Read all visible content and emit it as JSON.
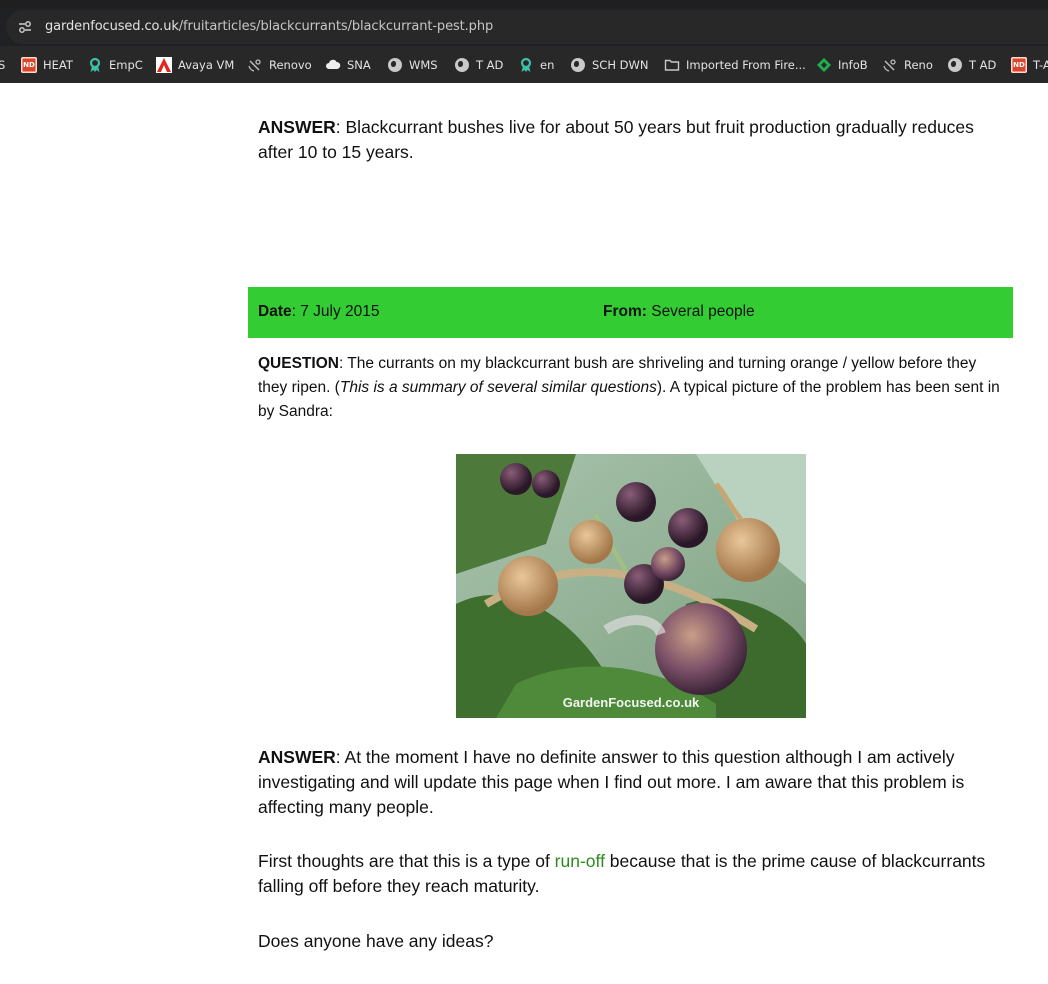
{
  "browser": {
    "url_host": "gardenfocused.co.uk",
    "url_path": "/fruitarticles/blackcurrants/blackcurrant-pest.php",
    "bookmarks": [
      {
        "label": "S",
        "icon": "cut-off-icon"
      },
      {
        "label": "HEAT",
        "icon": "nd-icon"
      },
      {
        "label": "EmpC",
        "icon": "ribbon-icon"
      },
      {
        "label": "Avaya VM",
        "icon": "adobe-icon"
      },
      {
        "label": "Renovo",
        "icon": "satellite-icon"
      },
      {
        "label": "SNA",
        "icon": "cloud-icon"
      },
      {
        "label": "WMS",
        "icon": "globe-icon"
      },
      {
        "label": "T AD",
        "icon": "globe-icon"
      },
      {
        "label": "en",
        "icon": "ribbon-icon"
      },
      {
        "label": "SCH DWN",
        "icon": "globe-icon"
      },
      {
        "label": "Imported From Fire...",
        "icon": "folder-icon"
      },
      {
        "label": "InfoB",
        "icon": "diamond-icon"
      },
      {
        "label": "Reno",
        "icon": "satellite-icon"
      },
      {
        "label": "T AD",
        "icon": "globe-icon"
      },
      {
        "label": "T-A",
        "icon": "nd-icon"
      }
    ]
  },
  "article": {
    "answer1_label": "ANSWER",
    "answer1_text": ": Blackcurrant bushes live for about 50 years but fruit production gradually reduces after 10 to 15 years.",
    "date_label": "Date",
    "date_value": ": 7 July 2015",
    "from_label": "From:",
    "from_value": " Several people",
    "question_label": "QUESTION",
    "question_text_1": ": The currants on my blackcurrant bush are shriveling and turning orange / yellow before they they ripen. (",
    "question_italic": "This is a summary of several similar questions",
    "question_text_2": "). A typical picture of the problem has been sent in by Sandra:",
    "image_watermark": "GardenFocused.co.uk",
    "answer2_label": "ANSWER",
    "answer2_text": ": At the moment I have no definite answer to this question although I am actively investigating and will update this page when I find out more. I am aware that this problem is affecting many people.",
    "thoughts_text_1": "First thoughts are that this is a type of ",
    "thoughts_link": "run-off",
    "thoughts_text_2": " because that is the prime cause of blackcurrants falling off before they reach maturity.",
    "ideas_text": "Does anyone have any ideas?"
  },
  "colors": {
    "header_bar": "#33cc33",
    "link": "#2e8b20"
  }
}
